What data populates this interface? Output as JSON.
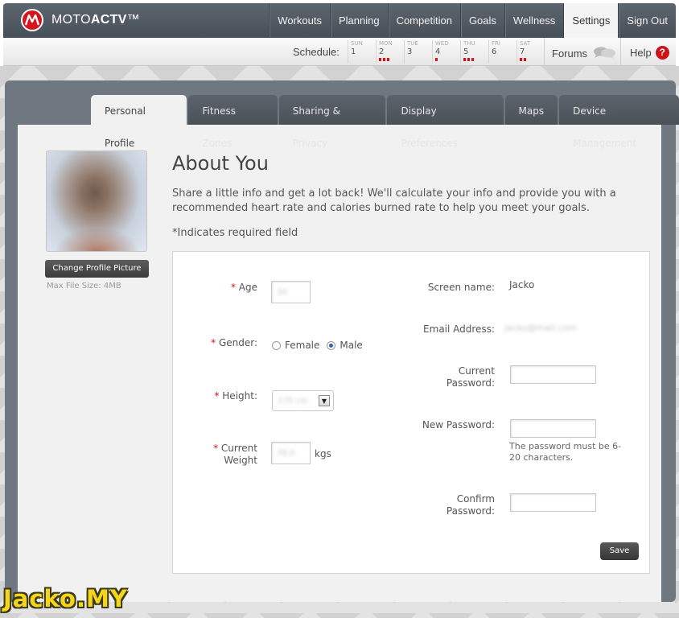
{
  "brand": {
    "name_light": "MOTO",
    "name_bold": "ACTV",
    "trademark": "™"
  },
  "nav": {
    "items": [
      "Workouts",
      "Planning",
      "Competition",
      "Goals",
      "Wellness",
      "Settings",
      "Sign Out"
    ],
    "active": "Settings"
  },
  "schedule": {
    "label": "Schedule:",
    "days": [
      {
        "dow": "SUN",
        "num": "1",
        "dots": 0
      },
      {
        "dow": "MON",
        "num": "2",
        "dots": 3
      },
      {
        "dow": "TUE",
        "num": "3",
        "dots": 0
      },
      {
        "dow": "WED",
        "num": "4",
        "dots": 1
      },
      {
        "dow": "THU",
        "num": "5",
        "dots": 3
      },
      {
        "dow": "FRI",
        "num": "6",
        "dots": 0
      },
      {
        "dow": "SAT",
        "num": "7",
        "dots": 2
      }
    ],
    "forums_label": "Forums",
    "help_label": "Help",
    "help_icon_glyph": "?"
  },
  "tabs": [
    "Personal Profile",
    "Fitness Zones",
    "Sharing & Privacy",
    "Display Preferences",
    "Maps",
    "Device Management"
  ],
  "profile": {
    "change_picture_label": "Change Profile Picture",
    "max_file_size": "Max File Size: 4MB"
  },
  "about": {
    "title": "About You",
    "description": "Share a little info and get a lot back! We'll calculate your info and provide you with a recommended heart rate and calories burned rate to help you meet your goals.",
    "required_note": "*Indicates required field"
  },
  "form": {
    "required_mark": "*",
    "age_label": "Age",
    "age_value": "34",
    "gender_label": "Gender:",
    "gender_options": [
      "Female",
      "Male"
    ],
    "gender_selected": "Male",
    "height_label": "Height:",
    "height_value": "175 cm",
    "weight_label_line1": "Current",
    "weight_label_line2": "Weight",
    "weight_value": "78.0",
    "weight_unit": "kgs",
    "screen_name_label": "Screen name:",
    "screen_name_value": "Jacko",
    "email_label": "Email Address:",
    "email_value": "jacko@mail.com",
    "current_password_label_line1": "Current",
    "current_password_label_line2": "Password:",
    "new_password_label": "New Password:",
    "password_hint": "The password must be 6-20 characters.",
    "confirm_password_label_line1": "Confirm",
    "confirm_password_label_line2": "Password:",
    "save_label": "Save"
  },
  "watermark": "Jacko.MY",
  "colors": {
    "brand_red": "#d6141c",
    "nav_bg": "#4f5760",
    "watermark_yellow": "#f5d51c"
  }
}
